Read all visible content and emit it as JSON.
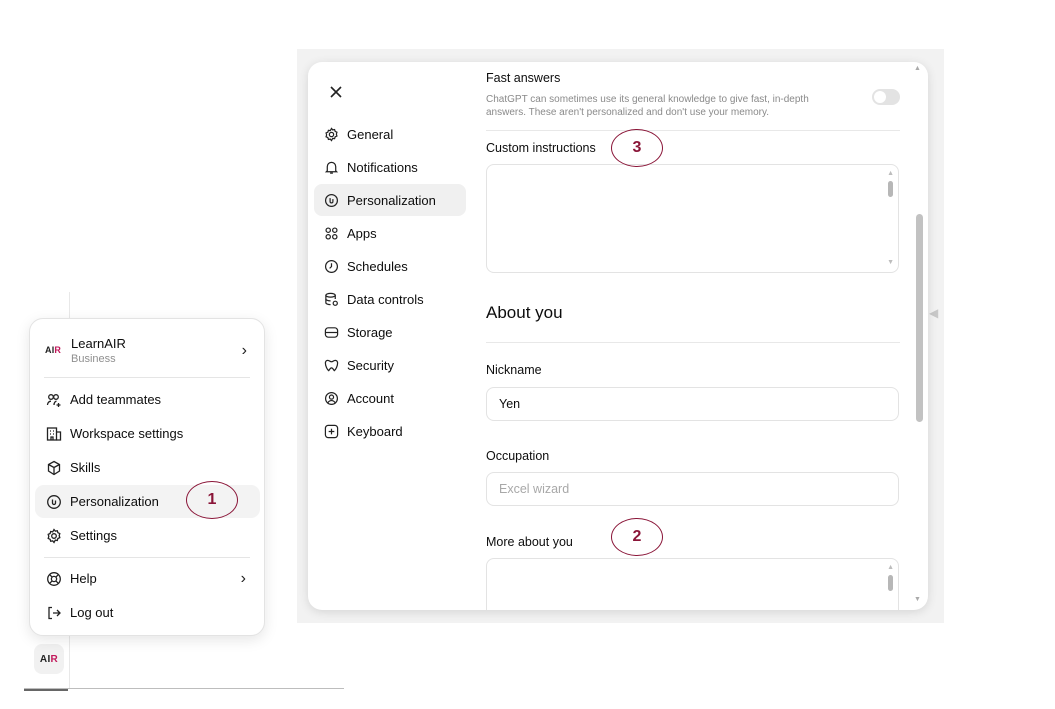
{
  "menu": {
    "workspace": {
      "logo_a": "AI",
      "logo_b": "R",
      "name": "LearnAIR",
      "plan": "Business"
    },
    "items": [
      {
        "label": "Add teammates",
        "icon": "add-user-icon"
      },
      {
        "label": "Workspace settings",
        "icon": "workspace-icon"
      },
      {
        "label": "Skills",
        "icon": "skills-icon"
      },
      {
        "label": "Personalization",
        "icon": "personalization-icon"
      },
      {
        "label": "Settings",
        "icon": "gear-icon"
      },
      {
        "label": "Help",
        "icon": "lifebuoy-icon"
      },
      {
        "label": "Log out",
        "icon": "logout-icon"
      }
    ]
  },
  "bottom_avatar": {
    "a": "AI",
    "b": "R"
  },
  "callouts": {
    "one": "1",
    "two": "2",
    "three": "3"
  },
  "settings": {
    "nav": [
      {
        "label": "General",
        "icon": "gear-icon"
      },
      {
        "label": "Notifications",
        "icon": "bell-icon"
      },
      {
        "label": "Personalization",
        "icon": "personalization-icon"
      },
      {
        "label": "Apps",
        "icon": "apps-icon"
      },
      {
        "label": "Schedules",
        "icon": "clock-icon"
      },
      {
        "label": "Data controls",
        "icon": "database-icon"
      },
      {
        "label": "Storage",
        "icon": "storage-icon"
      },
      {
        "label": "Security",
        "icon": "security-icon"
      },
      {
        "label": "Account",
        "icon": "account-icon"
      },
      {
        "label": "Keyboard",
        "icon": "keyboard-icon"
      }
    ],
    "active_nav": "Personalization",
    "fast_answers": {
      "title": "Fast answers",
      "description": "ChatGPT can sometimes use its general knowledge to give fast, in-depth answers. These aren't personalized and don't use your memory.",
      "enabled": false
    },
    "custom_instructions": {
      "label": "Custom instructions",
      "value": ""
    },
    "about_you": {
      "title": "About you",
      "nickname_label": "Nickname",
      "nickname_value": "Yen",
      "occupation_label": "Occupation",
      "occupation_placeholder": "Excel wizard",
      "more_label": "More about you",
      "more_value": ""
    }
  },
  "colors": {
    "accent": "#8a1538",
    "logo_red": "#c2185b"
  }
}
